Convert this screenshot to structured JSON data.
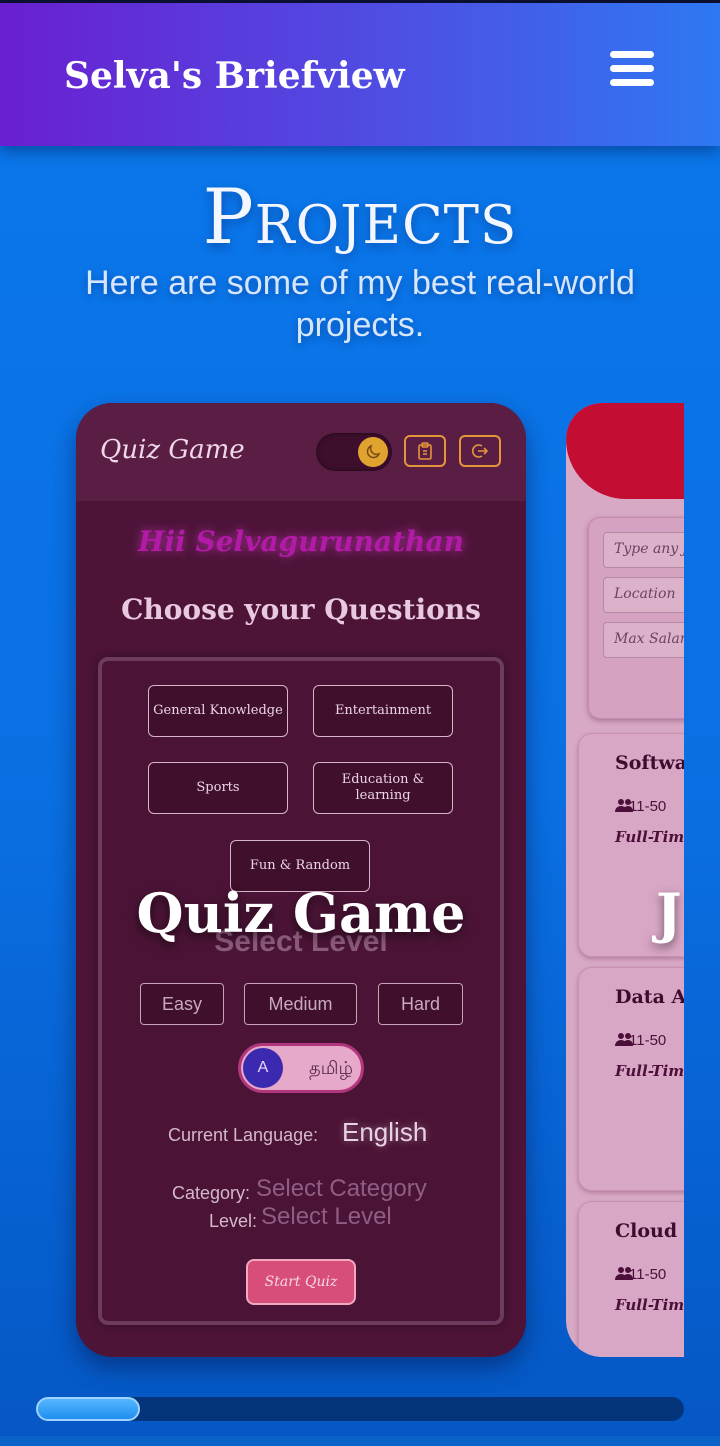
{
  "app": {
    "brand": "Selva's Briefview",
    "menu_icon": "hamburger-menu-icon"
  },
  "section": {
    "title": "Projects",
    "subtitle": "Here are some of my best real-world projects."
  },
  "quiz_project": {
    "overlay_title": "Quiz Game",
    "app_title": "Quiz Game",
    "theme_icon": "moon-icon",
    "icons": [
      "clipboard-icon",
      "logout-icon"
    ],
    "greeting": "Hii Selvagurunathan",
    "choose_label": "Choose your Questions",
    "categories": [
      "General Knowledge",
      "Entertainment",
      "Sports",
      "Education & learning",
      "Fun & Random"
    ],
    "select_level_label": "Select Level",
    "levels": [
      "Easy",
      "Medium",
      "Hard"
    ],
    "language_toggle": {
      "active": "A",
      "alternate": "தமிழ்"
    },
    "current_language_label": "Current Language:",
    "current_language_value": "English",
    "category_label": "Category:",
    "category_value": "Select Category",
    "level_label": "Level:",
    "level_value": "Select Level",
    "start_button": "Start Quiz"
  },
  "job_project": {
    "overlay_title": "J",
    "inputs": [
      "Type any jo",
      "Location",
      "Max Salar"
    ],
    "jobs": [
      {
        "title": "Softwar",
        "size": "11-50",
        "type": "Full-Tim"
      },
      {
        "title": "Data A",
        "size": "11-50",
        "type": "Full-Tim"
      },
      {
        "title": "Cloud E",
        "size": "11-50",
        "type": "Full-Tim"
      }
    ]
  },
  "carousel": {
    "scroll_progress": 0.16
  }
}
